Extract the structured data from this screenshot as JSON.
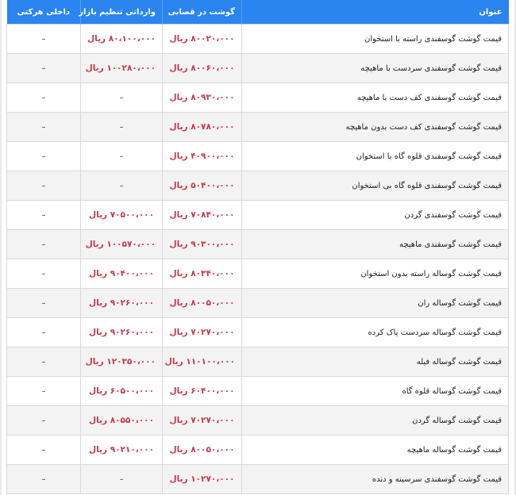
{
  "table": {
    "headers": {
      "title": "عنوان",
      "butcher": "گوشت در قصابی",
      "import": "وارداتی تنظیم بازار",
      "domestic": "داخلی هرکتی"
    },
    "rows": [
      {
        "title": "قیمت گوشت گوسفندی راسته با استخوان",
        "butcher": "۸۰۰۲۰،۰۰۰ ریال",
        "import": "۸۰،۱۰۰،۰۰۰ ریال",
        "domestic": "–"
      },
      {
        "title": "قیمت گوشت گوسفندی سردست با ماهیچه",
        "butcher": "۸۰۰۶۰،۰۰۰ ریال",
        "import": "۱۰۰۲۸۰،۰۰۰ ریال",
        "domestic": "–"
      },
      {
        "title": "قیمت گوشت گوسفندی کف دست با ماهیچه",
        "butcher": "۸۰۹۳۰،۰۰۰ ریال",
        "import": "–",
        "domestic": "–"
      },
      {
        "title": "قیمت گوشت گوسفندی کف دست بدون ماهیچه",
        "butcher": "۸۰۷۸۰،۰۰۰ ریال",
        "import": "–",
        "domestic": "–"
      },
      {
        "title": "قیمت گوشت گوسفندی قلوه گاه با استخوان",
        "butcher": "۴۰۹۰۰،۰۰۰ ریال",
        "import": "–",
        "domestic": "–"
      },
      {
        "title": "قیمت گوشت گوسفندی قلوه گاه بی استخوان",
        "butcher": "۵۰۴۰۰،۰۰۰ ریال",
        "import": "–",
        "domestic": "–"
      },
      {
        "title": "قیمت گوشت گوسفندی گردن",
        "butcher": "۷۰۸۴۰،۰۰۰ ریال",
        "import": "۷۰۵۰۰،۰۰۰ ریال",
        "domestic": "–"
      },
      {
        "title": "قیمت گوشت گوسفندی ماهیچه",
        "butcher": "۹۰۳۰۰،۰۰۰ ریال",
        "import": "۱۰۰۵۷۰،۰۰۰ ریال",
        "domestic": "–"
      },
      {
        "title": "قیمت گوشت گوساله راسته بدون استخوان",
        "butcher": "۸۰۳۴۰،۰۰۰ ریال",
        "import": "۹۰۴۰۰،۰۰۰ ریال",
        "domestic": "–"
      },
      {
        "title": "قیمت گوشت گوساله ران",
        "butcher": "۸۰۰۵۰،۰۰۰ ریال",
        "import": "۹۰۲۶۰،۰۰۰ ریال",
        "domestic": "–"
      },
      {
        "title": "قیمت گوشت گوساله سردست پاک کرده",
        "butcher": "۷۰۲۷۰،۰۰۰ ریال",
        "import": "۹۰۲۶۰،۰۰۰ ریال",
        "domestic": "–"
      },
      {
        "title": "قیمت گوشت گوساله فیله",
        "butcher": "۱۱۰۱۰۰،۰۰۰ ریال",
        "import": "۱۲۰۳۵۰،۰۰۰ ریال",
        "domestic": "–"
      },
      {
        "title": "قیمت گوشت گوساله قلوه گاه",
        "butcher": "۶۰۴۰۰،۰۰۰ ریال",
        "import": "۶۰۵۰۰،۰۰۰ ریال",
        "domestic": "–"
      },
      {
        "title": "قیمت گوشت گوساله گردن",
        "butcher": "۷۰۲۷۰،۰۰۰ ریال",
        "import": "۸۰۵۵۰،۰۰۰ ریال",
        "domestic": "–"
      },
      {
        "title": "قیمت گوشت گوساله ماهیچه",
        "butcher": "۸۰۰۵۰،۰۰۰ ریال",
        "import": "۹۰۲۱۰،۰۰۰ ریال",
        "domestic": "–"
      },
      {
        "title": "قیمت گوشت گوسفندی سرسینه و دنده",
        "butcher": "۱۰۲۷۰،۰۰۰ ریال",
        "import": "–",
        "domestic": "–"
      }
    ]
  }
}
